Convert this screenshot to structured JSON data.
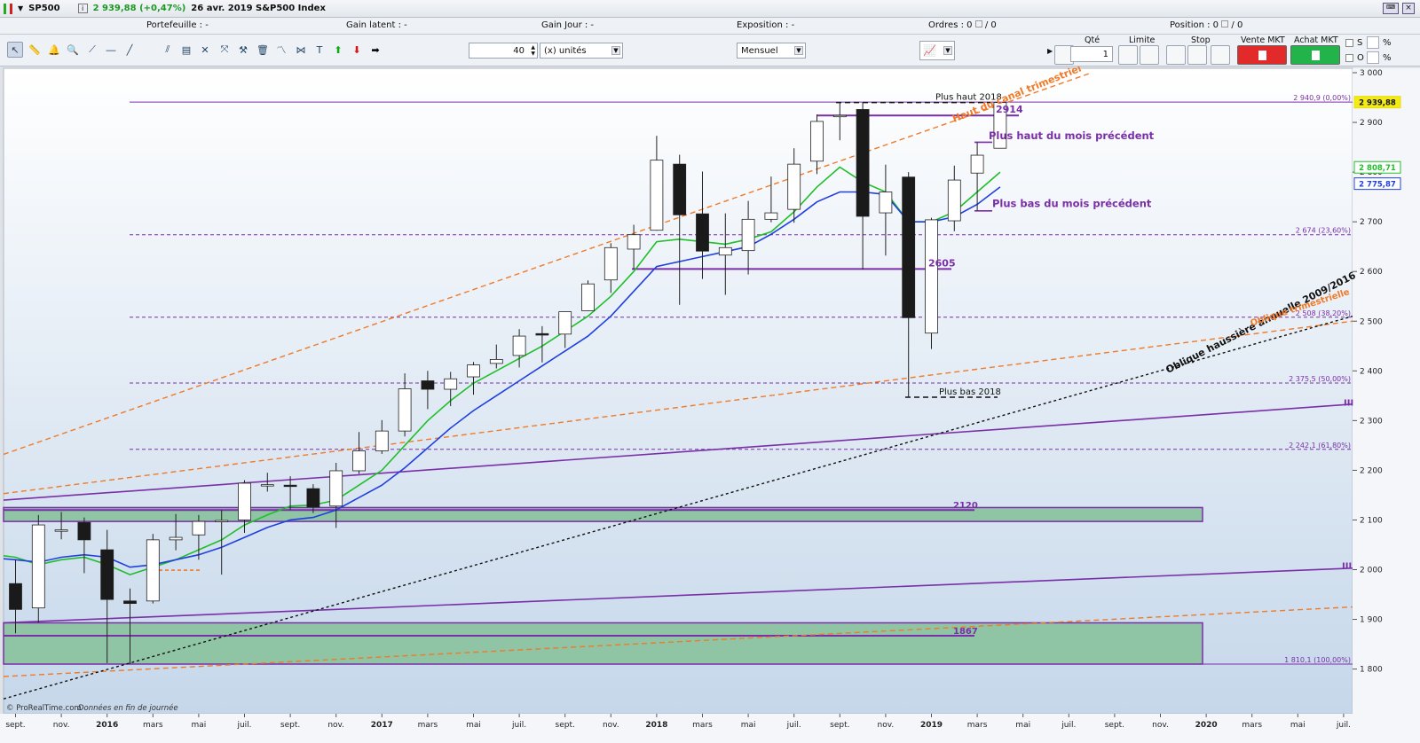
{
  "header": {
    "symbol": "SP500",
    "price_change": "2 939,88 (+0,47%)",
    "date_name": "26 avr. 2019 S&P500 Index"
  },
  "info": {
    "portefeuille": "Portefeuille : -",
    "gain_latent": "Gain latent : -",
    "gain_jour": "Gain Jour : -",
    "exposition": "Exposition : -",
    "ordres": "Ordres : 0",
    "ordres_b": "/ 0",
    "position": "Position : 0",
    "position_b": "/ 0"
  },
  "toolbar": {
    "quantity": "40",
    "unit": "(x) unités",
    "period": "Mensuel"
  },
  "order_panel": {
    "qte_label": "Qté",
    "qte_value": "1",
    "limite_label": "Limite",
    "stop_label": "Stop",
    "vente_label": "Vente MKT",
    "achat_label": "Achat MKT",
    "s_label": "S",
    "o_label": "O",
    "pct1": "%",
    "pct2": "%"
  },
  "colors": {
    "up_candle": "#ffffff",
    "down_candle": "#1a1a1a",
    "ma_fast": "#1fbf2a",
    "ma_slow": "#1f3fe0",
    "fib": "#7a2fa8",
    "channel": "#f07a28",
    "zone": "#8fc4a4"
  },
  "chart_data": {
    "type": "candlestick",
    "ylim": [
      1770,
      3000
    ],
    "y_ticks": [
      "3 000",
      "2 900",
      "2 800",
      "2 700",
      "2 600",
      "2 500",
      "2 400",
      "2 300",
      "2 200",
      "2 100",
      "2 000",
      "1 900",
      "1 800"
    ],
    "x_labels": [
      "sept.",
      "nov.",
      "2016",
      "mars",
      "mai",
      "juil.",
      "sept.",
      "nov.",
      "2017",
      "mars",
      "mai",
      "juil.",
      "sept.",
      "nov.",
      "2018",
      "mars",
      "mai",
      "juil.",
      "sept.",
      "nov.",
      "2019",
      "mars",
      "mai",
      "juil.",
      "sept.",
      "nov.",
      "2020",
      "mars",
      "mai",
      "juil."
    ],
    "candles": [
      {
        "o": 1972,
        "h": 2020,
        "l": 1872,
        "c": 1920
      },
      {
        "o": 1923,
        "h": 2110,
        "l": 1893,
        "c": 2090
      },
      {
        "o": 2080,
        "h": 2116,
        "l": 2061,
        "c": 2080
      },
      {
        "o": 2095,
        "h": 2105,
        "l": 1993,
        "c": 2060
      },
      {
        "o": 2040,
        "h": 2080,
        "l": 1812,
        "c": 1940
      },
      {
        "o": 1937,
        "h": 1962,
        "l": 1810,
        "c": 1932
      },
      {
        "o": 1937,
        "h": 2072,
        "l": 1932,
        "c": 2060
      },
      {
        "o": 2060,
        "h": 2112,
        "l": 2039,
        "c": 2065
      },
      {
        "o": 2070,
        "h": 2110,
        "l": 2020,
        "c": 2097
      },
      {
        "o": 2097,
        "h": 2120,
        "l": 1990,
        "c": 2099
      },
      {
        "o": 2100,
        "h": 2180,
        "l": 2074,
        "c": 2174
      },
      {
        "o": 2170,
        "h": 2195,
        "l": 2157,
        "c": 2171
      },
      {
        "o": 2170,
        "h": 2188,
        "l": 2120,
        "c": 2168
      },
      {
        "o": 2163,
        "h": 2172,
        "l": 2114,
        "c": 2126
      },
      {
        "o": 2128,
        "h": 2215,
        "l": 2084,
        "c": 2199
      },
      {
        "o": 2199,
        "h": 2277,
        "l": 2193,
        "c": 2239
      },
      {
        "o": 2239,
        "h": 2301,
        "l": 2233,
        "c": 2279
      },
      {
        "o": 2279,
        "h": 2395,
        "l": 2268,
        "c": 2364
      },
      {
        "o": 2380,
        "h": 2400,
        "l": 2323,
        "c": 2363
      },
      {
        "o": 2363,
        "h": 2398,
        "l": 2329,
        "c": 2384
      },
      {
        "o": 2388,
        "h": 2418,
        "l": 2352,
        "c": 2412
      },
      {
        "o": 2415,
        "h": 2453,
        "l": 2405,
        "c": 2423
      },
      {
        "o": 2431,
        "h": 2484,
        "l": 2407,
        "c": 2470
      },
      {
        "o": 2475,
        "h": 2490,
        "l": 2417,
        "c": 2472
      },
      {
        "o": 2474,
        "h": 2519,
        "l": 2446,
        "c": 2519
      },
      {
        "o": 2521,
        "h": 2582,
        "l": 2520,
        "c": 2575
      },
      {
        "o": 2583,
        "h": 2657,
        "l": 2557,
        "c": 2648
      },
      {
        "o": 2645,
        "h": 2694,
        "l": 2605,
        "c": 2674
      },
      {
        "o": 2683,
        "h": 2873,
        "l": 2682,
        "c": 2824
      },
      {
        "o": 2816,
        "h": 2835,
        "l": 2533,
        "c": 2714
      },
      {
        "o": 2716,
        "h": 2801,
        "l": 2585,
        "c": 2641
      },
      {
        "o": 2633,
        "h": 2717,
        "l": 2553,
        "c": 2648
      },
      {
        "o": 2642,
        "h": 2742,
        "l": 2594,
        "c": 2705
      },
      {
        "o": 2705,
        "h": 2791,
        "l": 2699,
        "c": 2718
      },
      {
        "o": 2725,
        "h": 2848,
        "l": 2698,
        "c": 2816
      },
      {
        "o": 2822,
        "h": 2916,
        "l": 2796,
        "c": 2902
      },
      {
        "o": 2912,
        "h": 2940,
        "l": 2864,
        "c": 2914
      },
      {
        "o": 2926,
        "h": 2940,
        "l": 2604,
        "c": 2711
      },
      {
        "o": 2718,
        "h": 2815,
        "l": 2632,
        "c": 2760
      },
      {
        "o": 2790,
        "h": 2800,
        "l": 2347,
        "c": 2507
      },
      {
        "o": 2476,
        "h": 2708,
        "l": 2444,
        "c": 2704
      },
      {
        "o": 2702,
        "h": 2813,
        "l": 2681,
        "c": 2784
      },
      {
        "o": 2798,
        "h": 2860,
        "l": 2722,
        "c": 2834
      },
      {
        "o": 2848,
        "h": 2940,
        "l": 2848,
        "c": 2940
      }
    ],
    "ma_fast": [
      2025,
      2010,
      2020,
      2025,
      2010,
      1990,
      2005,
      2020,
      2040,
      2060,
      2090,
      2110,
      2128,
      2130,
      2140,
      2170,
      2200,
      2250,
      2300,
      2340,
      2375,
      2400,
      2425,
      2450,
      2480,
      2510,
      2550,
      2600,
      2660,
      2665,
      2660,
      2655,
      2665,
      2680,
      2720,
      2770,
      2810,
      2780,
      2760,
      2700,
      2700,
      2720,
      2760,
      2800
    ],
    "ma_slow": [
      2020,
      2015,
      2025,
      2030,
      2025,
      2005,
      2010,
      2020,
      2030,
      2045,
      2065,
      2085,
      2100,
      2105,
      2120,
      2145,
      2170,
      2205,
      2245,
      2285,
      2320,
      2350,
      2380,
      2410,
      2440,
      2470,
      2510,
      2560,
      2610,
      2620,
      2630,
      2640,
      2650,
      2675,
      2705,
      2740,
      2760,
      2760,
      2755,
      2700,
      2700,
      2710,
      2735,
      2770
    ],
    "price_tags": [
      {
        "label": "2 939,88",
        "value": 2939.88,
        "color": "#e8e000"
      },
      {
        "label": "2 808,71",
        "value": 2808.71,
        "color": "#1fbf2a"
      },
      {
        "label": "2 775,87",
        "value": 2775.87,
        "color": "#1f3fe0"
      }
    ],
    "fib_levels": [
      {
        "value": 2940.9,
        "label": "2 940,9 (0,00%)"
      },
      {
        "value": 2674,
        "label": "2 674 (23,60%)"
      },
      {
        "value": 2508,
        "label": "2 508 (38,20%)"
      },
      {
        "value": 2375.5,
        "label": "2 375,5 (50,00%)"
      },
      {
        "value": 2242.1,
        "label": "2 242,1 (61,80%)"
      },
      {
        "value": 1810.1,
        "label": "1 810,1 (100,00%)"
      }
    ],
    "annotations": {
      "plus_haut_2018": "Plus haut 2018",
      "plus_bas_2018": "Plus bas 2018",
      "haut_canal": "Haut du canal trimestriel",
      "level_2914": "2914",
      "plus_haut_mois": "Plus haut du mois précédent",
      "plus_bas_mois": "Plus bas du mois précédent",
      "level_2605": "2605",
      "level_2120": "2120",
      "level_1867": "1867",
      "oblique": "Oblique haussière annuelle 2009/2016",
      "oblique_b": "Oblique trimestrielle",
      "roman_1": "III",
      "roman_2": "III",
      "credit": "© ProRealTime.com",
      "credit_b": "Données en fin de journée"
    }
  }
}
